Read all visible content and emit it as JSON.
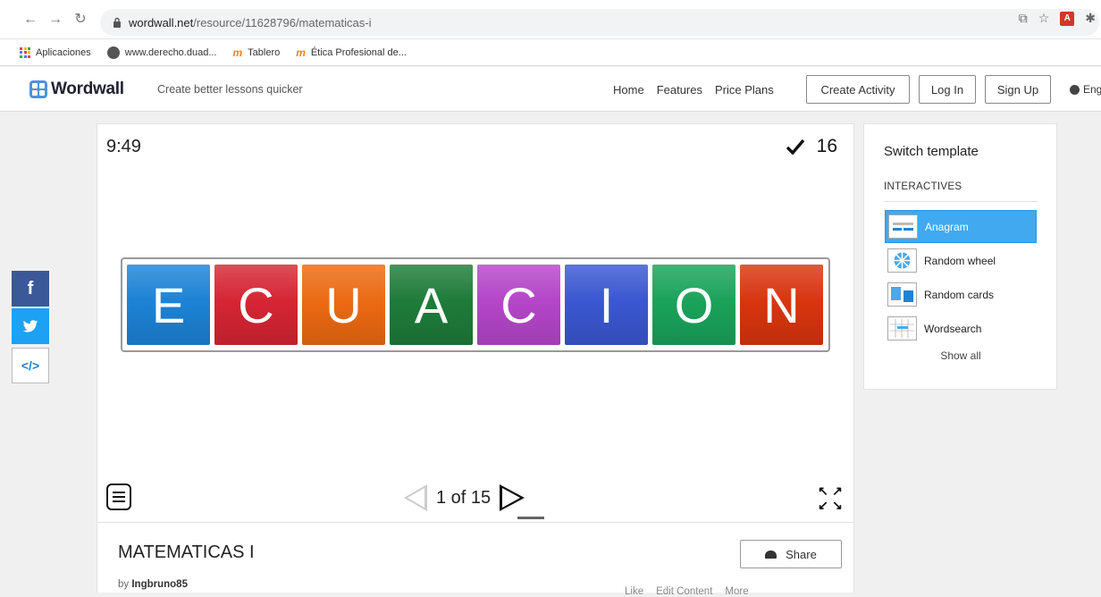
{
  "browser": {
    "url_host": "wordwall.net",
    "url_path": "/resource/11628796/matematicas-i",
    "bookmarks": [
      "Aplicaciones",
      "www.derecho.duad...",
      "Tablero",
      "Ética Profesional de..."
    ]
  },
  "header": {
    "logo": "Wordwall",
    "tagline": "Create better lessons quicker",
    "nav": [
      "Home",
      "Features",
      "Price Plans"
    ],
    "create_activity": "Create Activity",
    "login": "Log In",
    "signup": "Sign Up",
    "language": "Eng"
  },
  "social": [
    "f",
    "twitter",
    "</>"
  ],
  "game": {
    "timer": "9:49",
    "score": "16",
    "tiles": [
      {
        "letter": "E",
        "color": "#1d83d6"
      },
      {
        "letter": "C",
        "color": "#d62533"
      },
      {
        "letter": "U",
        "color": "#ec6a12"
      },
      {
        "letter": "A",
        "color": "#1e7c3a"
      },
      {
        "letter": "C",
        "color": "#b546c9"
      },
      {
        "letter": "I",
        "color": "#3b57d1"
      },
      {
        "letter": "O",
        "color": "#1aa35a"
      },
      {
        "letter": "N",
        "color": "#d9350f"
      }
    ],
    "pager": "1 of 15"
  },
  "activity": {
    "title": "MATEMATICAS I",
    "share": "Share",
    "by": "by",
    "author": "Ingbruno85",
    "actions": [
      "Like",
      "Edit Content",
      "More"
    ]
  },
  "sidebar": {
    "title": "Switch template",
    "section": "INTERACTIVES",
    "items": [
      {
        "label": "Anagram",
        "icon": "anagram-icon"
      },
      {
        "label": "Random wheel",
        "icon": "wheel-icon"
      },
      {
        "label": "Random cards",
        "icon": "cards-icon"
      },
      {
        "label": "Wordsearch",
        "icon": "wordsearch-icon"
      }
    ],
    "show_all": "Show all"
  },
  "colors": {
    "accent": "#41a9f0",
    "facebook": "#3b5998",
    "twitter": "#1da1f2"
  }
}
